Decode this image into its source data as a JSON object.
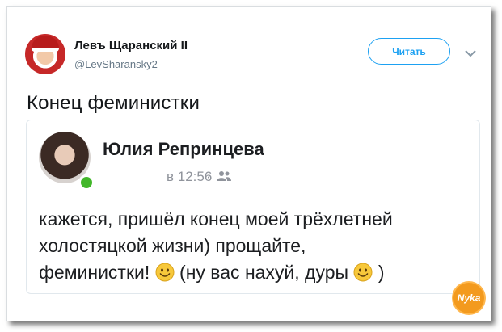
{
  "tweet": {
    "author_name": "Левъ Щаранский II",
    "author_handle": "@LevSharansky2",
    "follow_label": "Читать",
    "text": "Конец феминистки"
  },
  "embedded_post": {
    "author_name": "Юлия Репринцева",
    "timestamp": "в 12:56",
    "separator": "·",
    "text_line1": "кажется, пришёл конец моей трёхлетней",
    "text_line2": "холостяцкой жизни) прощайте,",
    "text_line3_a": "феминистки! ",
    "text_line3_b": " (ну вас нахуй, дуры ",
    "text_line3_c": " )"
  },
  "watermark": {
    "text": "Nyka"
  },
  "colors": {
    "accent": "#1da1f2",
    "online": "#42b72a",
    "watermark": "#f39a1e"
  },
  "icons": [
    "chevron-down-icon",
    "friends-icon",
    "smiley-emoji-icon",
    "online-status-dot"
  ]
}
